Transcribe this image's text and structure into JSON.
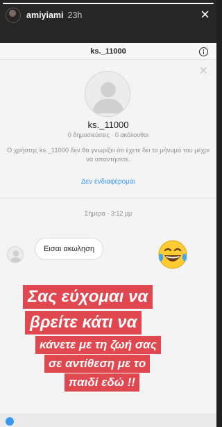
{
  "story": {
    "progress": 1.0,
    "username": "amiyiami",
    "time": "23h",
    "close_symbol": "×"
  },
  "dm": {
    "header_title": "ks._11000",
    "profile_name": "ks._11000",
    "profile_meta": "0 δημοσιεύσεις · 0 ακόλουθοι",
    "profile_note": "Ο χρήστης ks._11000 δεν θα γνωρίζει ότι έχετε δει το μήνυμά του μέχρι να απαντήσετε.",
    "not_interested": "Δεν ενδιαφέρομαι",
    "date_label": "Σήμερα - 3:12 μμ",
    "message": "Εισαι ακωληση",
    "link_color": "#3897f0"
  },
  "caption": {
    "line1": "Σας εύχομαι να",
    "line2": "βρείτε κάτι να",
    "line3": "κάνετε με τη ζωή σας",
    "line4": "σε αντίθεση με το",
    "line5": "παιδί εδώ !!",
    "background_color": "#e0474f"
  },
  "icons": {
    "emoji": "face-with-tears-of-joy-icon",
    "info": "info-icon",
    "close": "close-icon"
  }
}
